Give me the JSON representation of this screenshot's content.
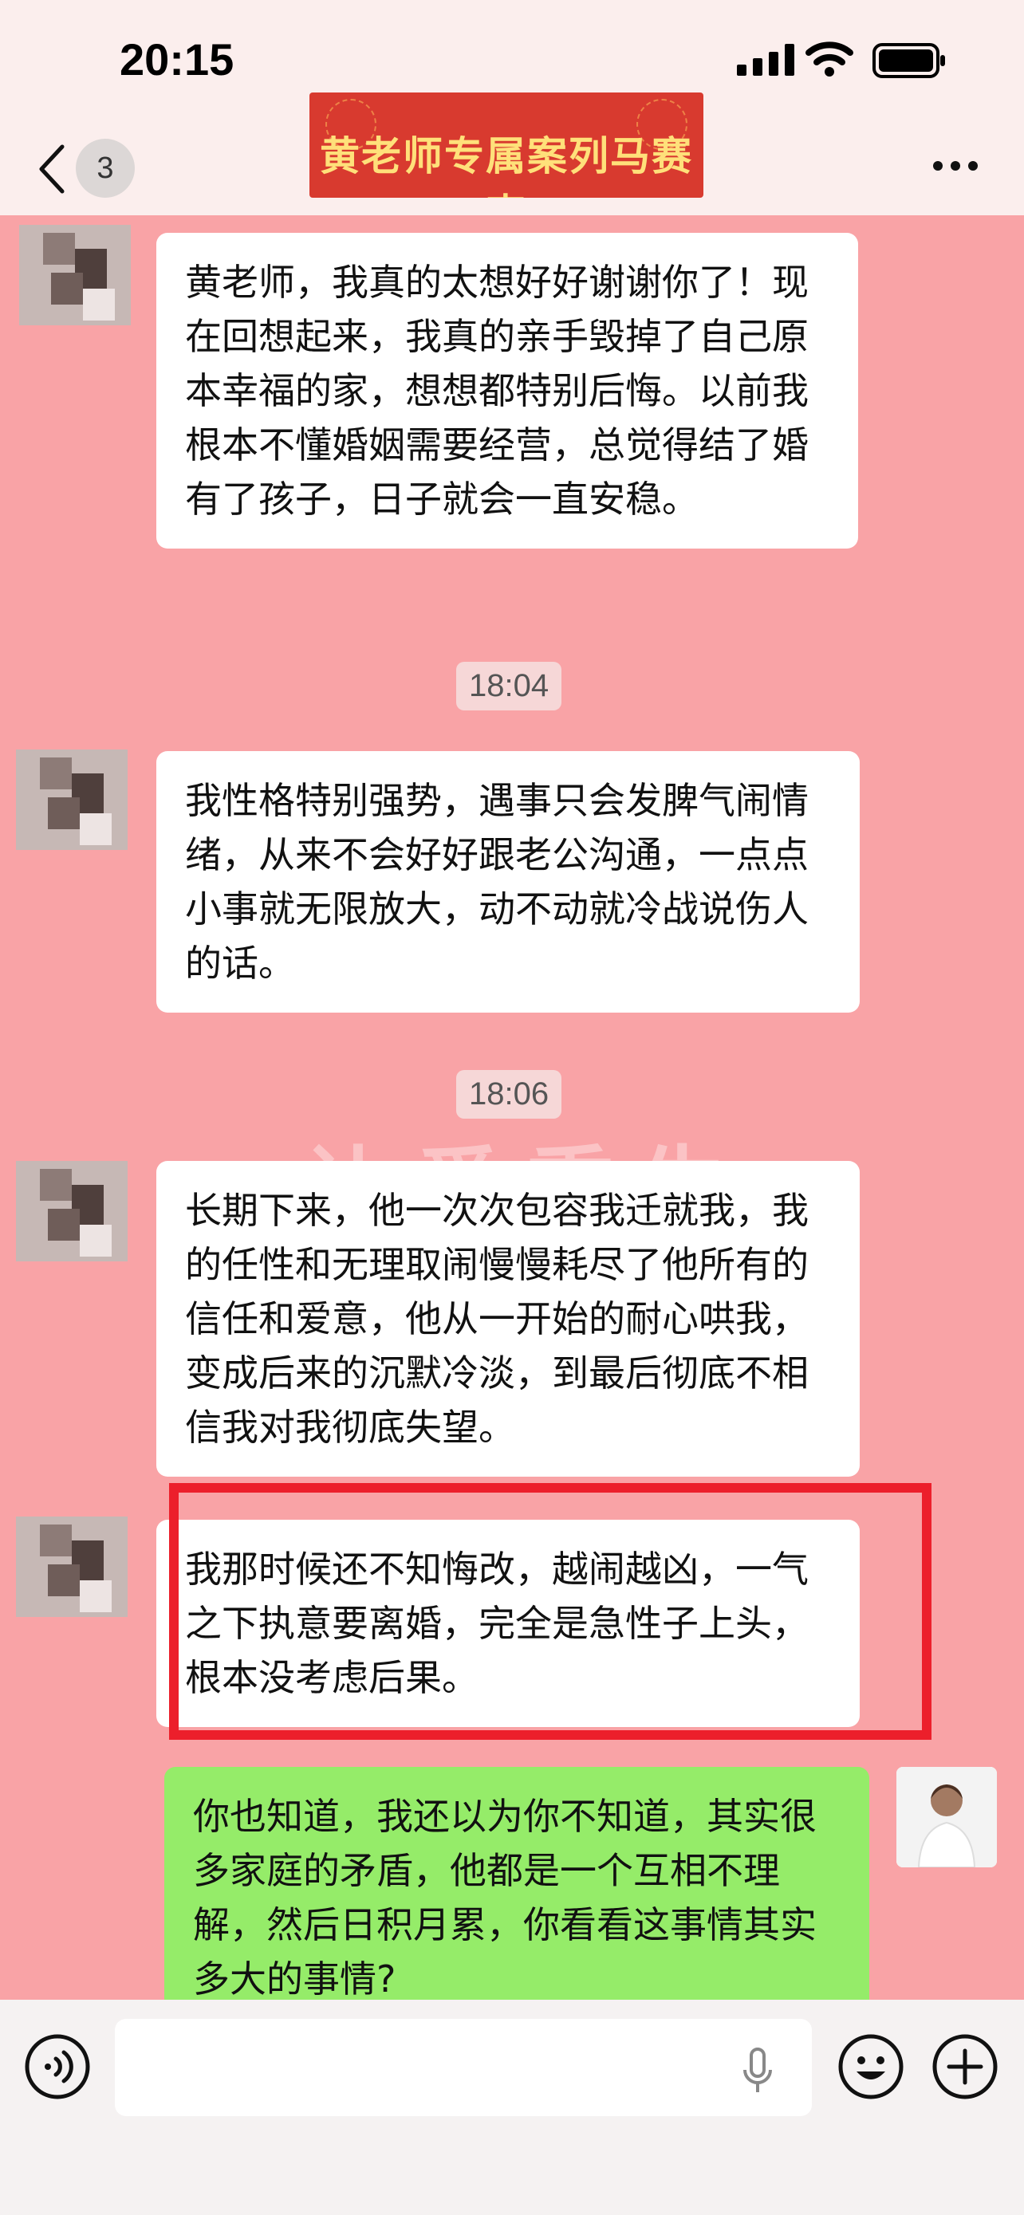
{
  "status_bar": {
    "time": "20:15"
  },
  "nav": {
    "unread_count": "3",
    "title": "黄老师专属案列马赛克"
  },
  "watermark": "让爱重生",
  "messages": [
    {
      "sender": "other",
      "text": "黄老师，我真的太想好好谢谢你了！现在回想起来，我真的亲手毁掉了自己原本幸福的家，想想都特别后悔。以前我根本不懂婚姻需要经营，总觉得结了婚有了孩子，日子就会一直安稳。"
    },
    {
      "timestamp": "18:04"
    },
    {
      "sender": "other",
      "text": "我性格特别强势，遇事只会发脾气闹情绪，从来不会好好跟老公沟通，一点点小事就无限放大，动不动就冷战说伤人的话。"
    },
    {
      "timestamp": "18:06"
    },
    {
      "sender": "other",
      "text": "长期下来，他一次次包容我迁就我，我的任性和无理取闹慢慢耗尽了他所有的信任和爱意，他从一开始的耐心哄我，变成后来的沉默冷淡，到最后彻底不相信我对我彻底失望。"
    },
    {
      "sender": "other",
      "highlighted": true,
      "text": "我那时候还不知悔改，越闹越凶，一气之下执意要离婚，完全是急性子上头，根本没考虑后果。"
    },
    {
      "sender": "self",
      "text": "你也知道，我还以为你不知道，其实很多家庭的矛盾，他都是一个互相不理解，然后日积月累，你看看这事情其实多大的事情?"
    }
  ],
  "input": {
    "placeholder": ""
  },
  "colors": {
    "chat_bg": "#f9a3a6",
    "highlight": "#ec1f2b",
    "self_bubble": "#95ec69",
    "title_banner": "#d83a2f"
  },
  "icons": [
    "back-icon",
    "more-icon",
    "voice-icon",
    "mic-icon",
    "emoji-icon",
    "plus-icon"
  ]
}
